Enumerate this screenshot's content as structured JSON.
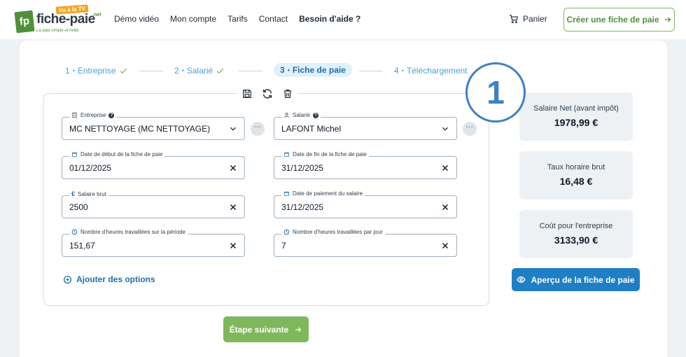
{
  "header": {
    "logo": {
      "name": "fiche-paie",
      "tv_badge": "Vu à la TV",
      "net": ".net",
      "tagline": "La paie simple et nette"
    },
    "nav": [
      {
        "label": "Démo vidéo"
      },
      {
        "label": "Mon compte"
      },
      {
        "label": "Tarifs"
      },
      {
        "label": "Contact"
      },
      {
        "label": "Besoin d'aide ?"
      }
    ],
    "cart_label": "Panier",
    "create_button": "Créer une fiche de paie"
  },
  "stepper": [
    {
      "num": "1",
      "label": "Entreprise",
      "done": true
    },
    {
      "num": "2",
      "label": "Salarié",
      "done": true
    },
    {
      "num": "3",
      "label": "Fiche de paie",
      "active": true
    },
    {
      "num": "4",
      "label": "Téléchargement"
    }
  ],
  "badge_number": "1",
  "form": {
    "entreprise": {
      "label": "Entreprise",
      "value": "MC NETTOYAGE (MC NETTOYAGE)"
    },
    "salarie": {
      "label": "Salarié",
      "value": "LAFONT Michel"
    },
    "date_debut": {
      "label": "Date de début de la fiche de paie",
      "value": "01/12/2025"
    },
    "date_fin": {
      "label": "Date de fin de la fiche de paie",
      "value": "31/12/2025"
    },
    "salaire_brut": {
      "label": "Salaire brut",
      "value": "2500"
    },
    "date_paiement": {
      "label": "Date de paiement du salaire",
      "value": "31/12/2025"
    },
    "heures_periode": {
      "label": "Nombre d'heures travaillées sur la période",
      "value": "151,67"
    },
    "heures_jour": {
      "label": "Nombre d'heures travaillées par jour",
      "value": "7"
    },
    "more_glyph": "···",
    "add_options": "Ajouter des options",
    "next_button": "Étape suivante"
  },
  "summary": [
    {
      "title": "Salaire Net (avant impôt)",
      "value": "1978,99 €"
    },
    {
      "title": "Taux horaire brut",
      "value": "16,48 €"
    },
    {
      "title": "Coût pour l'entreprise",
      "value": "3133,90 €"
    }
  ],
  "preview_button": "Aperçu de la fiche de paie",
  "colors": {
    "green": "#7fb85c",
    "blue": "#1e7fc4",
    "accent_blue": "#3f7fc8"
  }
}
